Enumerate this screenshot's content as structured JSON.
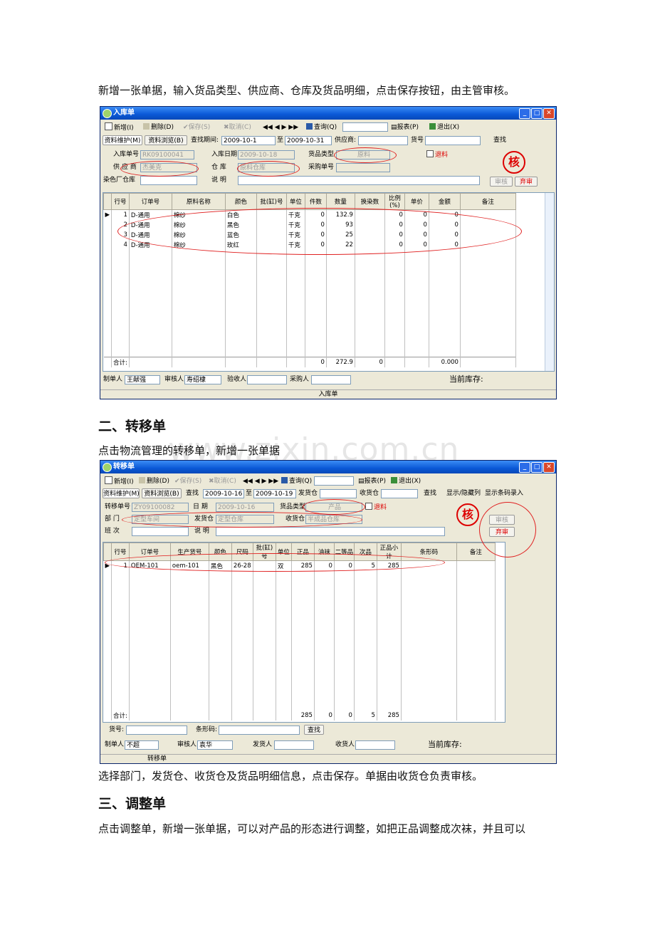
{
  "doc": {
    "para1": "新增一张单据，输入货品类型、供应商、仓库及货品明细，点击保存按钮，由主管审核。",
    "heading2": "二、转移单",
    "para2": "点击物流管理的转移单，新增一张单据",
    "watermark": "www.zixin.com.cn",
    "para3": "选择部门，发货仓、收货仓及货品明细信息，点击保存。单据由收货仓负责审核。",
    "heading3": "三、调整单",
    "para4": "点击调整单，新增一张单据，可以对产品的形态进行调整，如把正品调整成次袜，并且可以"
  },
  "win1": {
    "title": "入库单",
    "toolbar": [
      "新增(I)",
      "删除(D)",
      "保存(S)",
      "取消(C)",
      "查询(Q)",
      "报表(P)",
      "退出(X)"
    ],
    "nav": "◀◀ ◀ ▶ ▶▶",
    "tabs": [
      "资料维护(M)",
      "资料浏览(B)"
    ],
    "filter": {
      "period_label": "查找期间:",
      "from": "2009-10-1",
      "to_label": "至",
      "to": "2009-10-31",
      "supplier_label": "供应商:",
      "goods_label": "货号",
      "find": "查找"
    },
    "form": {
      "no_label": "入库单号",
      "no": "RK09100041",
      "date_label": "入库日期",
      "date": "2009-10-18",
      "type_label": "货品类型",
      "type": "原料",
      "return_label": "退料",
      "supplier_label": "供 应 商",
      "supplier": "杰美克",
      "wh_label": "仓    库",
      "wh": "原料仓库",
      "po_label": "采购单号",
      "dye_label": "染色厂仓库",
      "note_label": "说    明",
      "audit": "审核",
      "abandon": "弃审",
      "stamp": "核"
    },
    "columns": [
      "行号",
      "订单号",
      "原料名称",
      "颜色",
      "批(缸)号",
      "单位",
      "件数",
      "数量",
      "换染数",
      "比例(%)",
      "单价",
      "金额",
      "备注"
    ],
    "rows": [
      [
        "1",
        "D-通用",
        "棉纱",
        "白色",
        "",
        "千克",
        "0",
        "132.9",
        "",
        "0",
        "0",
        "0",
        ""
      ],
      [
        "2",
        "D-通用",
        "棉纱",
        "黑色",
        "",
        "千克",
        "0",
        "93",
        "",
        "0",
        "0",
        "0",
        ""
      ],
      [
        "3",
        "D-通用",
        "棉纱",
        "蓝色",
        "",
        "千克",
        "0",
        "25",
        "",
        "0",
        "0",
        "0",
        ""
      ],
      [
        "4",
        "D-通用",
        "棉纱",
        "玫红",
        "",
        "千克",
        "0",
        "22",
        "",
        "0",
        "0",
        "0",
        ""
      ]
    ],
    "total": [
      "合计:",
      "",
      "",
      "",
      "",
      "",
      "0",
      "272.9",
      "0",
      "",
      "",
      "0.000",
      ""
    ],
    "footer": {
      "maker_label": "制单人",
      "maker": "王献强",
      "auditor_label": "审核人",
      "auditor": "寿绍棣",
      "receiver_label": "验收人",
      "buyer_label": "采购人",
      "stock_label": "当前库存:"
    },
    "status": "入库单"
  },
  "win2": {
    "title": "转移单",
    "toolbar": [
      "新增(I)",
      "删除(D)",
      "保存(S)",
      "取消(C)",
      "查询(Q)",
      "报表(P)",
      "退出(X)"
    ],
    "tabs": [
      "资料维护(M)",
      "资料浏览(B)"
    ],
    "filter": {
      "find_label": "查找",
      "from": "2009-10-16",
      "to_label": "至",
      "to": "2009-10-19",
      "send_label": "发货仓",
      "recv_label": "收货仓",
      "find": "查找",
      "toggle": "显示/隐藏列",
      "barcode": "显示条码录入"
    },
    "form": {
      "no_label": "转移单号",
      "no": "ZY09100082",
      "date_label": "日    期",
      "date": "2009-10-16",
      "type_label": "货品类型",
      "type": "产品",
      "return_label": "退料",
      "dept_label": "部    门",
      "dept": "定型车间",
      "send_label": "发货仓",
      "send": "定型仓库",
      "recv_label": "收货仓",
      "recv": "半成品仓库",
      "shift_label": "班    次",
      "note_label": "说    明",
      "audit": "审核",
      "abandon": "弃审",
      "stamp": "核"
    },
    "columns": [
      "行号",
      "订单号",
      "生产货号",
      "颜色",
      "尺码",
      "批(缸)号",
      "单位",
      "正品",
      "油袜",
      "二等品",
      "次品",
      "正品小计",
      "条形码",
      "备注"
    ],
    "rows": [
      [
        "1",
        "OEM-101",
        "oem-101",
        "黑色",
        "26-28",
        "",
        "双",
        "285",
        "0",
        "0",
        "5",
        "285",
        "",
        ""
      ]
    ],
    "total": [
      "合计:",
      "",
      "",
      "",
      "",
      "",
      "",
      "285",
      "0",
      "0",
      "5",
      "285",
      "",
      ""
    ],
    "search": {
      "goods_label": "货号:",
      "barcode_label": "条形码:",
      "find": "查找"
    },
    "footer": {
      "maker_label": "制单人",
      "maker": "不超",
      "auditor_label": "审核人",
      "auditor": "袁华",
      "sender_label": "发货人",
      "receiver_label": "收货人",
      "stock_label": "当前库存:"
    },
    "status": "转移单"
  }
}
